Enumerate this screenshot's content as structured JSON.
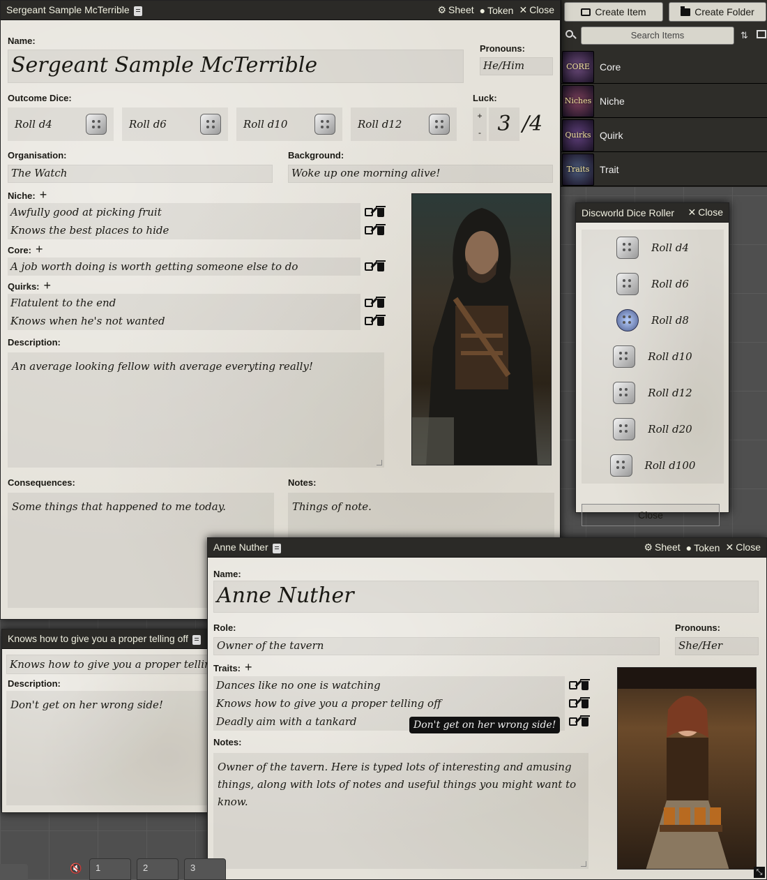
{
  "sheet1": {
    "title": "Sergeant Sample McTerrible",
    "header_buttons": {
      "sheet": "Sheet",
      "token": "Token",
      "close": "Close"
    },
    "name_label": "Name:",
    "name": "Sergeant Sample McTerrible",
    "pronouns_label": "Pronouns:",
    "pronouns": "He/Him",
    "outcome_dice_label": "Outcome Dice:",
    "dice": [
      "Roll d4",
      "Roll d6",
      "Roll d10",
      "Roll d12"
    ],
    "luck_label": "Luck:",
    "luck_plus": "+",
    "luck_minus": "-",
    "luck_value": "3",
    "luck_max": "/4",
    "organisation_label": "Organisation:",
    "organisation": "The Watch",
    "background_label": "Background:",
    "background": "Woke up one morning alive!",
    "niche_label": "Niche:",
    "niches": [
      "Awfully good at picking fruit",
      "Knows the best places to hide"
    ],
    "core_label": "Core:",
    "cores": [
      "A job worth doing is worth getting someone else to do"
    ],
    "quirks_label": "Quirks:",
    "quirks": [
      "Flatulent to the end",
      "Knows when he's not wanted"
    ],
    "description_label": "Description:",
    "description": "An average looking fellow with average everyting really!",
    "consequences_label": "Consequences:",
    "consequences": "Some things that happened to me today.",
    "notes_label": "Notes:",
    "notes": "Things of note."
  },
  "sidebar": {
    "create_item": "Create Item",
    "create_folder": "Create Folder",
    "search_placeholder": "Search Items",
    "items": [
      {
        "label": "Core",
        "thumb": "CORE",
        "color": "#6b4a7a"
      },
      {
        "label": "Niche",
        "thumb": "Niches",
        "color": "#7a3f5a"
      },
      {
        "label": "Quirk",
        "thumb": "Quirks",
        "color": "#5e3f7a"
      },
      {
        "label": "Trait",
        "thumb": "Traits",
        "color": "#4a5a7a"
      }
    ]
  },
  "dice_roller": {
    "title": "Discworld Dice Roller",
    "close": "Close",
    "rolls": [
      "Roll d4",
      "Roll d6",
      "Roll d8",
      "Roll d10",
      "Roll d12",
      "Roll d20",
      "Roll d100"
    ],
    "close_button": "Close"
  },
  "item_window": {
    "title": "Knows how to give you a proper telling off",
    "name": "Knows how to give you a proper telling off",
    "description_label": "Description:",
    "description": "Don't get on her wrong side!"
  },
  "sheet2": {
    "title": "Anne Nuther",
    "header_buttons": {
      "sheet": "Sheet",
      "token": "Token",
      "close": "Close"
    },
    "name_label": "Name:",
    "name": "Anne Nuther",
    "role_label": "Role:",
    "role": "Owner of the tavern",
    "pronouns_label": "Pronouns:",
    "pronouns": "She/Her",
    "traits_label": "Traits:",
    "traits": [
      "Dances like no one is watching",
      "Knows how to give you a proper telling off",
      "Deadly aim with a tankard"
    ],
    "tooltip": "Don't get on her wrong side!",
    "notes_label": "Notes:",
    "notes": "Owner of the tavern. Here is typed lots of interesting and amusing things, along with lots of notes and useful things you might want to know."
  },
  "hotbar": [
    "1",
    "2",
    "3"
  ]
}
